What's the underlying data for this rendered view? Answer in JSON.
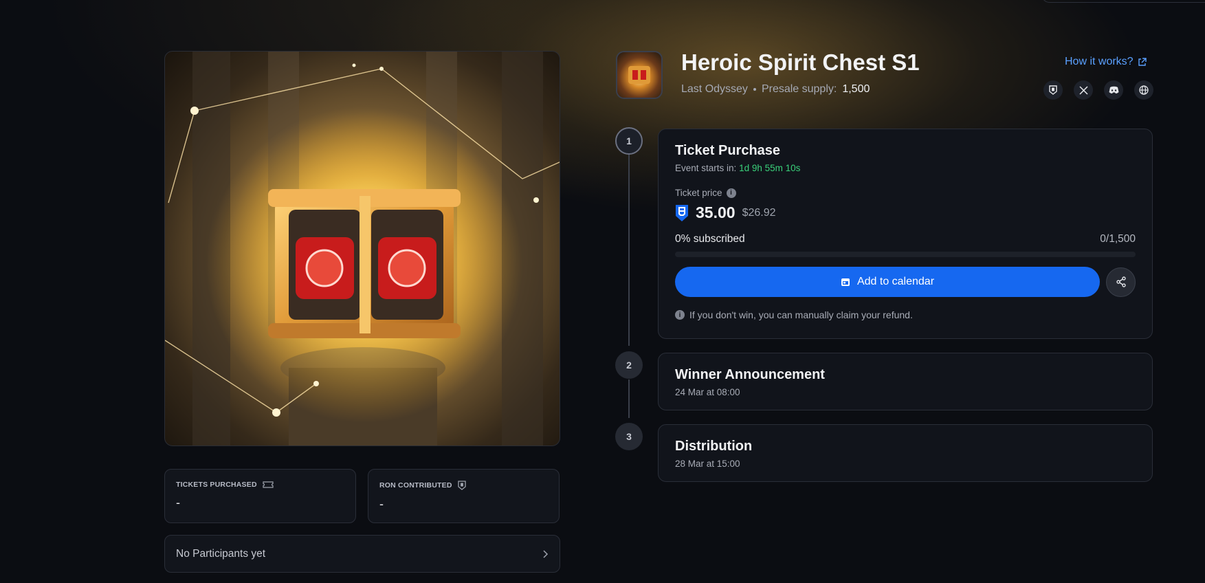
{
  "header": {
    "title": "Heroic Spirit Chest S1",
    "project": "Last Odyssey",
    "supply_label": "Presale supply:",
    "supply_value": "1,500",
    "how_it_works": "How it works?",
    "socials": [
      "ronin-icon",
      "x-icon",
      "discord-icon",
      "globe-icon"
    ]
  },
  "stats": {
    "tickets_label": "TICKETS PURCHASED",
    "tickets_value": "-",
    "ron_label": "RON CONTRIBUTED",
    "ron_value": "-"
  },
  "participants": {
    "label": "No Participants yet"
  },
  "steps": [
    {
      "number": "1",
      "title": "Ticket Purchase",
      "event_label": "Event starts in:",
      "countdown": "1d 9h 55m 10s",
      "ticket_price_label": "Ticket price",
      "price": "35.00",
      "price_usd": "$26.92",
      "subscribed_label": "0% subscribed",
      "subscribed_fraction": 0,
      "subscribed_count": "0/1,500",
      "calendar_button": "Add to calendar",
      "refund_note": "If you don't win, you can manually claim your refund."
    },
    {
      "number": "2",
      "title": "Winner Announcement",
      "date": "24 Mar at 08:00"
    },
    {
      "number": "3",
      "title": "Distribution",
      "date": "28 Mar at 15:00"
    }
  ],
  "colors": {
    "accent": "#1668f0",
    "link": "#5aa0ff",
    "countdown": "#3ad07a",
    "background": "#0b0d12"
  }
}
